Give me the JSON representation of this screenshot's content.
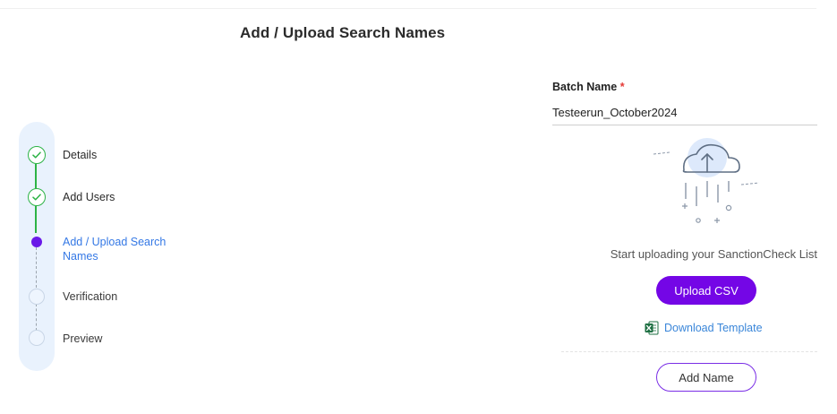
{
  "page": {
    "title": "Add / Upload Search Names"
  },
  "stepper": {
    "steps": [
      {
        "label": "Details",
        "status": "completed"
      },
      {
        "label": "Add Users",
        "status": "completed"
      },
      {
        "label": "Add / Upload Search Names",
        "status": "active"
      },
      {
        "label": "Verification",
        "status": "pending"
      },
      {
        "label": "Preview",
        "status": "pending"
      }
    ]
  },
  "batch": {
    "label": "Batch Name",
    "required_mark": "*",
    "value": "Testeerun_October2024"
  },
  "upload": {
    "illustration_icon": "cloud-upload-icon",
    "hint": "Start uploading your SanctionCheck List",
    "upload_button_label": "Upload CSV",
    "download_icon": "excel-file-icon",
    "download_label": "Download Template"
  },
  "add_name": {
    "button_label": "Add Name"
  },
  "colors": {
    "accent_purple": "#7406e6",
    "active_step": "#6a1ae8",
    "completed_green": "#2db346",
    "link_blue": "#3a86d9",
    "stepper_bg": "#e9f2fd",
    "required_red": "#e53935"
  }
}
